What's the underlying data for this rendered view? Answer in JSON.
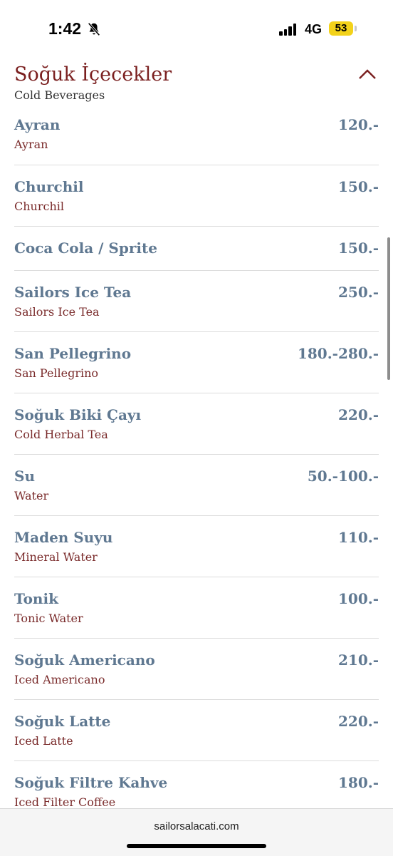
{
  "status": {
    "time": "1:42",
    "network": "4G",
    "battery": "53"
  },
  "section": {
    "title": "Soğuk İçecekler",
    "subtitle": "Cold Beverages"
  },
  "items": [
    {
      "name": "Ayran",
      "price": "120.-",
      "desc": "Ayran"
    },
    {
      "name": "Churchil",
      "price": "150.-",
      "desc": "Churchil"
    },
    {
      "name": "Coca Cola / Sprite",
      "price": "150.-",
      "desc": ""
    },
    {
      "name": "Sailors Ice Tea",
      "price": "250.-",
      "desc": "Sailors Ice Tea"
    },
    {
      "name": "San Pellegrino",
      "price": "180.-280.-",
      "desc": "San Pellegrino"
    },
    {
      "name": "Soğuk Biki Çayı",
      "price": "220.-",
      "desc": "Cold Herbal Tea"
    },
    {
      "name": "Su",
      "price": "50.-100.-",
      "desc": "Water"
    },
    {
      "name": "Maden Suyu",
      "price": "110.-",
      "desc": "Mineral Water"
    },
    {
      "name": "Tonik",
      "price": "100.-",
      "desc": "Tonic Water"
    },
    {
      "name": "Soğuk Americano",
      "price": "210.-",
      "desc": "Iced Americano"
    },
    {
      "name": "Soğuk Latte",
      "price": "220.-",
      "desc": "Iced Latte"
    },
    {
      "name": "Soğuk Filtre Kahve",
      "price": "180.-",
      "desc": "Iced Filter Coffee"
    }
  ],
  "browser": {
    "url": "sailorsalacati.com"
  }
}
